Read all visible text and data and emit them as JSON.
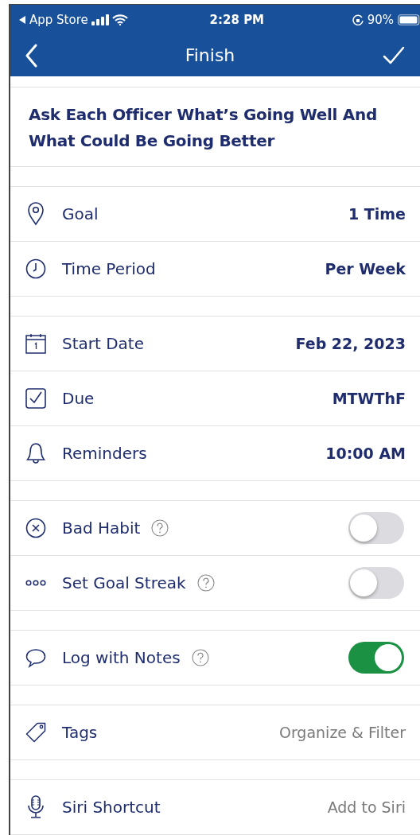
{
  "status_bar": {
    "back_app": "App Store",
    "time": "2:28 PM",
    "battery": "90%"
  },
  "nav_bar": {
    "title": "Finish"
  },
  "habit_title": "Ask Each Officer What’s Going Well And What Could Be Going Better",
  "sections": [
    {
      "rows": [
        {
          "kind": "value",
          "label": "Goal",
          "value": "1 Time"
        },
        {
          "kind": "value",
          "label": "Time Period",
          "value": "Per Week"
        }
      ]
    },
    {
      "rows": [
        {
          "kind": "value",
          "label": "Start Date",
          "value": "Feb 22, 2023"
        },
        {
          "kind": "value",
          "label": "Due",
          "value": "MTWThF"
        },
        {
          "kind": "value",
          "label": "Reminders",
          "value": "10:00 AM"
        }
      ]
    },
    {
      "rows": [
        {
          "kind": "toggle",
          "label": "Bad Habit",
          "help": true,
          "on": false
        },
        {
          "kind": "toggle",
          "label": "Set Goal Streak",
          "help": true,
          "on": false
        }
      ]
    },
    {
      "rows": [
        {
          "kind": "toggle",
          "label": "Log with Notes",
          "help": true,
          "on": true
        }
      ]
    },
    {
      "rows": [
        {
          "kind": "link",
          "label": "Tags",
          "value": "Organize & Filter"
        }
      ]
    },
    {
      "rows": [
        {
          "kind": "link",
          "label": "Siri Shortcut",
          "value": "Add to Siri"
        }
      ]
    }
  ]
}
